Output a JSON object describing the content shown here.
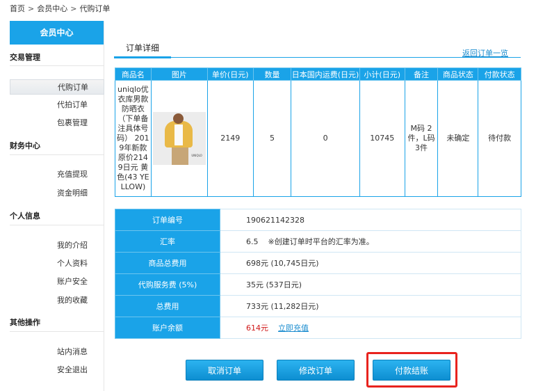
{
  "breadcrumb": {
    "home": "首页",
    "member": "会员中心",
    "current": "代购订单",
    "sep": ">"
  },
  "sidebar": {
    "title": "会员中心",
    "sections": {
      "trade": "交易管理",
      "finance": "财务中心",
      "personal": "个人信息",
      "other": "其他操作"
    },
    "items": {
      "proxy_order": "代购订单",
      "auction_order": "代拍订单",
      "package_mgmt": "包裹管理",
      "recharge": "充值提现",
      "funds_detail": "资金明细",
      "intro": "我的介绍",
      "profile": "个人资料",
      "security": "账户安全",
      "favorites": "我的收藏",
      "messages": "站内消息",
      "logout": "安全退出"
    }
  },
  "tabs": {
    "detail": "订单详细",
    "return": "返回订单一览"
  },
  "product_table": {
    "headers": [
      "商品名",
      "图片",
      "单价(日元)",
      "数量",
      "日本国内运费(日元)",
      "小计(日元)",
      "备注",
      "商品状态",
      "付款状态"
    ],
    "row": {
      "name": "uniqlo优衣库男款防晒衣（下单备注具体号码） 2019年新款原价2149日元 黄色(43 YELLOW)",
      "unit_price": "2149",
      "quantity": "5",
      "shipping": "0",
      "subtotal": "10745",
      "remark": "M码 2件，L码 3件",
      "product_status": "未确定",
      "payment_status": "待付款",
      "image_tag": "UNIQLO"
    }
  },
  "summary": {
    "order_no_label": "订单编号",
    "order_no": "190621142328",
    "rate_label": "汇率",
    "rate": "6.5",
    "rate_note": "※创建订单时平台的汇率为准。",
    "goods_total_label": "商品总费用",
    "goods_total": "698元 (10,745日元)",
    "service_fee_label": "代购服务费 (5%)",
    "service_fee": "35元 (537日元)",
    "total_label": "总费用",
    "total": "733元 (11,282日元)",
    "balance_label": "账户余额",
    "balance": "614元",
    "recharge_link": "立即充值"
  },
  "buttons": {
    "cancel": "取消订单",
    "modify": "修改订单",
    "pay": "付款结账"
  },
  "colors": {
    "accent": "#1aa3e8",
    "red": "#d01818",
    "highlight": "#e8231e"
  }
}
